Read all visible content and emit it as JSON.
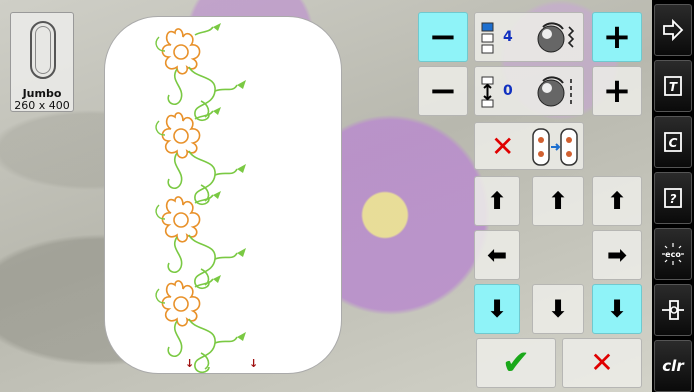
{
  "hoop": {
    "name": "Jumbo",
    "size": "260 x 400"
  },
  "controls": {
    "repeat_count": "4",
    "spacing_value": "0"
  },
  "colors": {
    "accent_cyan": "#8ff3f8",
    "value_blue": "#1030c0",
    "cancel_red": "#e00000",
    "confirm_green": "#1aa81a",
    "motif_orange": "#e8912a",
    "motif_green": "#7ac943"
  },
  "icons": {
    "toolbar": [
      "enter-arrow-icon",
      "text-file-icon",
      "c-file-icon",
      "help-file-icon",
      "eco-icon",
      "thread-spool-icon",
      "clr-icon"
    ],
    "clr_label": "clr",
    "eco_label": "eco"
  }
}
